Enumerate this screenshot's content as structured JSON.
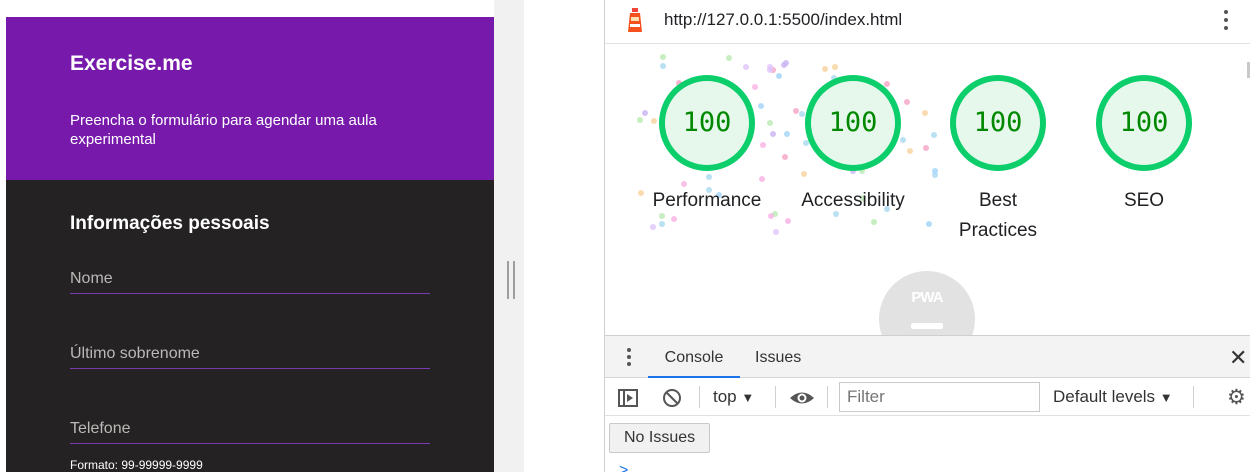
{
  "app": {
    "title": "Exercise.me",
    "subtitle": "Preencha o formulário para agendar uma aula experimental",
    "section_title": "Informações pessoais",
    "fields": {
      "name_placeholder": "Nome",
      "lastname_placeholder": "Último sobrenome",
      "phone_placeholder": "Telefone",
      "phone_hint": "Formato: 99-99999-9999"
    },
    "colors": {
      "header": "#7719aa",
      "body": "#242222",
      "field_line": "#7b3bb0"
    }
  },
  "devtools": {
    "url": "http://127.0.0.1:5500/index.html",
    "lighthouse": {
      "scores": [
        {
          "value": "100",
          "label": "Performance"
        },
        {
          "value": "100",
          "label": "Accessibility"
        },
        {
          "value": "100",
          "label": "Best Practices"
        },
        {
          "value": "100",
          "label": "SEO"
        }
      ],
      "pwa_label": "PWA",
      "colors": {
        "pass": "#0cce6b",
        "pass_text": "#008800"
      }
    },
    "drawer": {
      "tabs": {
        "console": "Console",
        "issues": "Issues"
      },
      "context": "top",
      "filter_placeholder": "Filter",
      "levels": "Default levels",
      "no_issues": "No Issues",
      "prompt": ">"
    }
  }
}
